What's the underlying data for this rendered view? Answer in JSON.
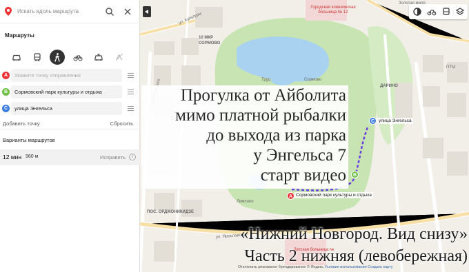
{
  "search": {
    "placeholder": "Искать вдоль маршрута"
  },
  "panel": {
    "title": "Маршруты",
    "modes": [
      "car-icon",
      "bus-icon",
      "pedestrian-icon",
      "bicycle-icon",
      "taxi-icon",
      "scooter-icon"
    ],
    "waypoints": [
      {
        "letter": "A",
        "value": "",
        "placeholder": "Укажите точку отправления",
        "color": "#ee3338"
      },
      {
        "letter": "B",
        "value": "Сормовский парк культуры и отдыха",
        "color": "#6cbe45"
      },
      {
        "letter": "C",
        "value": "улица Энгельса",
        "color": "#3b7ce0"
      }
    ],
    "add_point": "Добавить точку",
    "reset": "Сбросить",
    "variants_title": "Варианты маршрутов",
    "route": {
      "time": "12 мин",
      "distance": "960 м",
      "edit": "Исправить"
    }
  },
  "map": {
    "labels": {
      "street_kultury": "ул. Культуры",
      "mkr": "10 МКР",
      "mkr2": "СОРМОВО",
      "street_tsiolkovskogo": "ул. Циолковского",
      "trud": "Труд",
      "sormovo": "Сормово",
      "limpopo": "Лимпопо",
      "darino": "ДАРИНО",
      "ptm": "ПТМ",
      "hospital": "Городская клиническая больница № 12",
      "children_hospital": "Детская больница №",
      "pos": "ПОС. ОРДЖОНИКИДЗЕ",
      "yaroslavskaya": "ул. Ярославская",
      "zolotaya": "Золотая миля"
    },
    "marker_a_label": "Сормовский парк культуры и отдыха",
    "marker_c_label": "улица Энгельса",
    "attribution_pre": "Отключить рекламное брендирование",
    "attribution_yandex": "© Яндекс",
    "attribution_terms": "Условия использования",
    "attribution_make": "Создать карту"
  },
  "overlay": {
    "lines": [
      "Прогулка от Айболита",
      "мимо платной рыбалки",
      "до выхода из парка",
      "у Энгельса 7",
      "старт видео"
    ]
  },
  "footer_overlay": {
    "lines": [
      "«Нижний Новгород. Вид снизу»",
      "Часть 2 нижняя (левобережная)"
    ]
  },
  "colors": {
    "park": "#c8e4b2",
    "water": "#a8d2f0",
    "route": "#6a3fe0",
    "accent": "#ee3338"
  }
}
